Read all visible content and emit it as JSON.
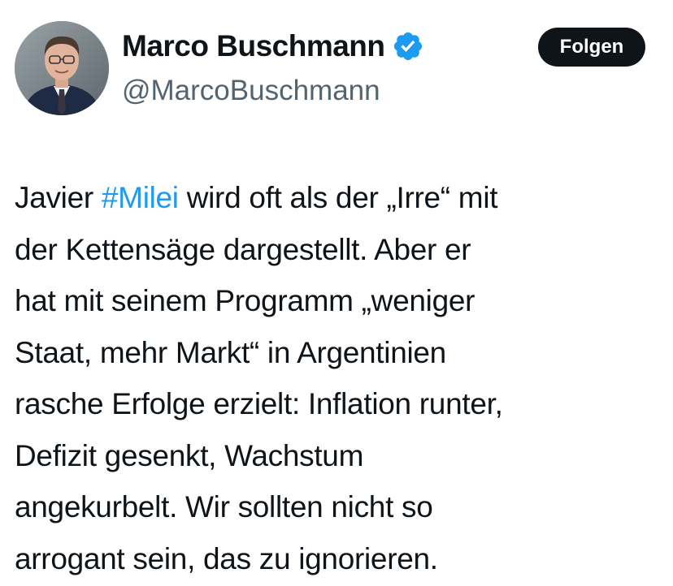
{
  "author": {
    "display_name": "Marco Buschmann",
    "handle": "@MarcoBuschmann",
    "verified_badge_icon": "verified-badge-icon",
    "verified_color": "#1d9bf0"
  },
  "follow_button": {
    "label": "Folgen"
  },
  "tweet": {
    "line1_prefix": "Javier ",
    "hashtag": "#Milei",
    "line1_suffix": " wird oft als der „Irre“ mit",
    "lines": [
      "der Kettensäge dargestellt. Aber er",
      "hat mit seinem Programm „weniger",
      "Staat, mehr Markt“ in Argentinien",
      "rasche Erfolge erzielt: Inflation runter,",
      "Defizit gesenkt, Wachstum",
      "angekurbelt. Wir sollten nicht so",
      "arrogant sein, das zu ignorieren."
    ]
  },
  "colors": {
    "text": "#0f1419",
    "secondary": "#536471",
    "link": "#1d9bf0",
    "button_bg": "#0f1419",
    "button_text": "#ffffff"
  }
}
